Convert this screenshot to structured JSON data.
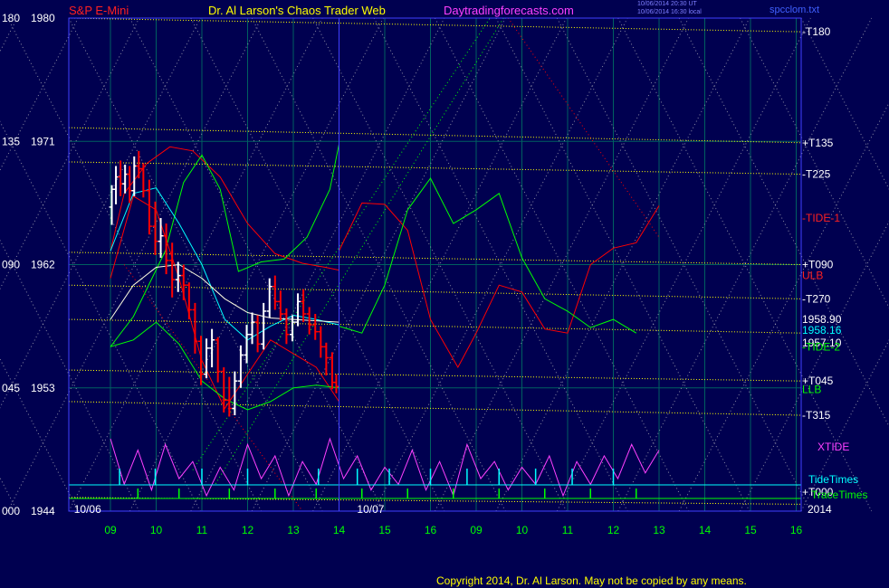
{
  "header": {
    "instrument": "S&P E-Mini",
    "author": "Dr. Al Larson's Chaos Trader Web",
    "site": "Daytradingforecasts.com",
    "timestamp_1": "10/06/2014 20:30 UT",
    "timestamp_2": "10/06/2014 16:30 local",
    "file": "spcclom.txt"
  },
  "colors": {
    "background": "#000050",
    "frame": "#4040ff",
    "grid": "#006060",
    "price_bar": "#ffffff",
    "price_bar_down": "#ff0000",
    "yellow": "#ffff00",
    "green": "#00ff00",
    "red": "#ff0000",
    "cyan": "#00ffff",
    "magenta": "#ff40ff"
  },
  "footer": {
    "copyright": "Copyright 2014, Dr. Al Larson. May not be copied by any means."
  },
  "chart_data": {
    "type": "line",
    "y_axis_left": {
      "range": [
        1944,
        1980
      ],
      "ticks": [
        {
          "angle": "180",
          "price": "1980"
        },
        {
          "angle": "135",
          "price": "1971"
        },
        {
          "angle": "090",
          "price": "1962"
        },
        {
          "angle": "045",
          "price": "1953"
        },
        {
          "angle": "000",
          "price": "1944"
        }
      ]
    },
    "x_axis": {
      "day_labels": [
        "10/06",
        "10/07"
      ],
      "year_label": "2014",
      "ticks": [
        {
          "hour": "09",
          "day": 1
        },
        {
          "hour": "10",
          "day": 1
        },
        {
          "hour": "11",
          "day": 1
        },
        {
          "hour": "12",
          "day": 1
        },
        {
          "hour": "13",
          "day": 1
        },
        {
          "hour": "14",
          "day": 1
        },
        {
          "hour": "15",
          "day": 1
        },
        {
          "hour": "16",
          "day": 1
        },
        {
          "hour": "09",
          "day": 2
        },
        {
          "hour": "10",
          "day": 2
        },
        {
          "hour": "11",
          "day": 2
        },
        {
          "hour": "12",
          "day": 2
        },
        {
          "hour": "13",
          "day": 2
        },
        {
          "hour": "14",
          "day": 2
        },
        {
          "hour": "15",
          "day": 2
        },
        {
          "hour": "16",
          "day": 2
        }
      ]
    },
    "grid": true,
    "right_labels": [
      {
        "text": "-T180",
        "price": 1979.0,
        "color": "#ffffff"
      },
      {
        "text": "+T135",
        "price": 1970.9,
        "color": "#ffffff"
      },
      {
        "text": "-T225",
        "price": 1968.6,
        "color": "#ffffff"
      },
      {
        "text": "-TIDE-1",
        "price": 1965.4,
        "color": "#ff2020"
      },
      {
        "text": "+T090",
        "price": 1962.0,
        "color": "#ffffff"
      },
      {
        "text": "ULB",
        "price": 1961.2,
        "color": "#ff2020"
      },
      {
        "text": "-T270",
        "price": 1959.5,
        "color": "#ffffff"
      },
      {
        "text": "1958.90",
        "price": 1958.0,
        "color": "#ffffff"
      },
      {
        "text": "1958.16",
        "price": 1957.2,
        "color": "#00ffff"
      },
      {
        "text": "1957.10",
        "price": 1956.3,
        "color": "#ffffff"
      },
      {
        "text": "-TIDE-2",
        "price": 1956.0,
        "color": "#00ff00"
      },
      {
        "text": "+T045",
        "price": 1953.5,
        "color": "#ffffff"
      },
      {
        "text": "LLB",
        "price": 1952.9,
        "color": "#00ff00"
      },
      {
        "text": "-T315",
        "price": 1951.0,
        "color": "#ffffff"
      }
    ],
    "lower_labels": [
      {
        "text": "XTIDE",
        "color": "#ff40ff"
      },
      {
        "text": "TideTimes",
        "color": "#00ffff"
      },
      {
        "text": "+T000",
        "color": "#ffffff"
      },
      {
        "text": "TraceTimes",
        "color": "#00ff00"
      }
    ],
    "time_lines": [
      {
        "name": "T180",
        "start": 1980.0,
        "end": 1979.0
      },
      {
        "name": "T135a",
        "start": 1972.0,
        "end": 1970.9
      },
      {
        "name": "T225",
        "start": 1969.5,
        "end": 1968.6
      },
      {
        "name": "T090",
        "start": 1962.9,
        "end": 1962.0
      },
      {
        "name": "T270",
        "start": 1960.5,
        "end": 1959.5
      },
      {
        "name": "Tmid",
        "start": 1958.0,
        "end": 1957.0
      },
      {
        "name": "T045",
        "start": 1954.3,
        "end": 1953.5
      },
      {
        "name": "T315",
        "start": 1952.0,
        "end": 1951.0
      },
      {
        "name": "T000",
        "start": 1945.0,
        "end": 1944.5
      }
    ],
    "price_bars": [
      {
        "t": 0.03,
        "o": 1966.2,
        "h": 1967.8,
        "l": 1964.9,
        "c": 1967.5
      },
      {
        "t": 0.12,
        "o": 1967.5,
        "h": 1969.2,
        "l": 1966.4,
        "c": 1968.4
      },
      {
        "t": 0.22,
        "o": 1968.4,
        "h": 1969.6,
        "l": 1967.0,
        "c": 1967.9
      },
      {
        "t": 0.32,
        "o": 1967.9,
        "h": 1969.3,
        "l": 1967.2,
        "c": 1968.6
      },
      {
        "t": 0.42,
        "o": 1968.6,
        "h": 1969.2,
        "l": 1966.5,
        "c": 1967.4
      },
      {
        "t": 0.52,
        "o": 1967.4,
        "h": 1969.9,
        "l": 1967.0,
        "c": 1969.2
      },
      {
        "t": 0.62,
        "o": 1969.2,
        "h": 1970.3,
        "l": 1968.3,
        "c": 1969.0
      },
      {
        "t": 0.72,
        "o": 1969.0,
        "h": 1969.4,
        "l": 1966.9,
        "c": 1967.4
      },
      {
        "t": 0.85,
        "o": 1967.4,
        "h": 1968.2,
        "l": 1964.2,
        "c": 1964.8
      },
      {
        "t": 0.98,
        "o": 1964.8,
        "h": 1966.6,
        "l": 1962.7,
        "c": 1963.7
      },
      {
        "t": 1.1,
        "o": 1963.7,
        "h": 1965.4,
        "l": 1962.5,
        "c": 1964.1
      },
      {
        "t": 1.22,
        "o": 1964.1,
        "h": 1965.0,
        "l": 1961.3,
        "c": 1962.3
      },
      {
        "t": 1.35,
        "o": 1962.3,
        "h": 1963.6,
        "l": 1959.6,
        "c": 1960.9
      },
      {
        "t": 1.48,
        "o": 1960.9,
        "h": 1962.2,
        "l": 1960.0,
        "c": 1961.2
      },
      {
        "t": 1.6,
        "o": 1961.2,
        "h": 1962.0,
        "l": 1959.4,
        "c": 1960.5
      },
      {
        "t": 1.72,
        "o": 1960.5,
        "h": 1960.7,
        "l": 1958.0,
        "c": 1958.7
      },
      {
        "t": 1.85,
        "o": 1958.7,
        "h": 1959.2,
        "l": 1955.5,
        "c": 1956.4
      },
      {
        "t": 1.98,
        "o": 1956.4,
        "h": 1956.8,
        "l": 1953.2,
        "c": 1954.0
      },
      {
        "t": 2.1,
        "o": 1954.0,
        "h": 1956.6,
        "l": 1953.7,
        "c": 1955.9
      },
      {
        "t": 2.22,
        "o": 1955.9,
        "h": 1957.3,
        "l": 1954.5,
        "c": 1956.5
      },
      {
        "t": 2.35,
        "o": 1956.5,
        "h": 1956.7,
        "l": 1953.4,
        "c": 1954.2
      },
      {
        "t": 2.48,
        "o": 1954.2,
        "h": 1954.5,
        "l": 1951.2,
        "c": 1952.1
      },
      {
        "t": 2.6,
        "o": 1952.1,
        "h": 1953.8,
        "l": 1950.9,
        "c": 1951.5
      },
      {
        "t": 2.72,
        "o": 1951.5,
        "h": 1954.2,
        "l": 1951.0,
        "c": 1953.5
      },
      {
        "t": 2.85,
        "o": 1953.5,
        "h": 1956.1,
        "l": 1953.0,
        "c": 1955.4
      },
      {
        "t": 2.98,
        "o": 1955.4,
        "h": 1957.6,
        "l": 1954.8,
        "c": 1956.9
      },
      {
        "t": 3.1,
        "o": 1956.9,
        "h": 1958.5,
        "l": 1956.2,
        "c": 1957.8
      },
      {
        "t": 3.22,
        "o": 1957.8,
        "h": 1958.3,
        "l": 1955.6,
        "c": 1956.2
      },
      {
        "t": 3.35,
        "o": 1956.2,
        "h": 1959.2,
        "l": 1955.8,
        "c": 1958.6
      },
      {
        "t": 3.48,
        "o": 1958.6,
        "h": 1961.0,
        "l": 1958.1,
        "c": 1960.4
      },
      {
        "t": 3.6,
        "o": 1960.4,
        "h": 1961.2,
        "l": 1958.7,
        "c": 1959.3
      },
      {
        "t": 3.72,
        "o": 1959.3,
        "h": 1960.1,
        "l": 1957.9,
        "c": 1958.4
      },
      {
        "t": 3.85,
        "o": 1958.4,
        "h": 1958.8,
        "l": 1956.2,
        "c": 1956.9
      },
      {
        "t": 3.98,
        "o": 1956.9,
        "h": 1958.3,
        "l": 1956.4,
        "c": 1957.8
      },
      {
        "t": 4.1,
        "o": 1957.8,
        "h": 1959.9,
        "l": 1957.5,
        "c": 1959.3
      },
      {
        "t": 4.22,
        "o": 1959.3,
        "h": 1960.2,
        "l": 1957.8,
        "c": 1958.4
      },
      {
        "t": 4.35,
        "o": 1958.4,
        "h": 1958.9,
        "l": 1956.9,
        "c": 1957.6
      },
      {
        "t": 4.48,
        "o": 1957.6,
        "h": 1958.4,
        "l": 1956.5,
        "c": 1957.1
      },
      {
        "t": 4.6,
        "o": 1957.1,
        "h": 1957.5,
        "l": 1955.2,
        "c": 1956.0
      },
      {
        "t": 4.72,
        "o": 1956.0,
        "h": 1956.3,
        "l": 1953.9,
        "c": 1955.2
      },
      {
        "t": 4.85,
        "o": 1955.2,
        "h": 1955.6,
        "l": 1952.9,
        "c": 1953.4
      },
      {
        "t": 4.94,
        "o": 1953.4,
        "h": 1954.0,
        "l": 1952.6,
        "c": 1953.1
      }
    ],
    "ulb_1": [
      [
        0,
        1963
      ],
      [
        0.3,
        1967.2
      ],
      [
        0.8,
        1969.4
      ],
      [
        1.3,
        1970.6
      ],
      [
        1.8,
        1970.3
      ],
      [
        2.4,
        1968.4
      ],
      [
        3.0,
        1965.0
      ],
      [
        3.6,
        1962.8
      ],
      [
        4.2,
        1962.1
      ],
      [
        4.7,
        1961.8
      ],
      [
        5.0,
        1961.6
      ]
    ],
    "llb_1": [
      [
        0,
        1956
      ],
      [
        0.5,
        1958.2
      ],
      [
        1.2,
        1963
      ],
      [
        1.6,
        1968
      ],
      [
        2.0,
        1970.0
      ],
      [
        2.4,
        1967.5
      ],
      [
        2.8,
        1961.5
      ],
      [
        3.3,
        1962.2
      ],
      [
        3.8,
        1962.4
      ],
      [
        4.3,
        1964
      ],
      [
        4.8,
        1967.5
      ],
      [
        5.0,
        1970.8
      ]
    ],
    "ma_cyan": [
      [
        0,
        1963
      ],
      [
        0.5,
        1967.2
      ],
      [
        1.0,
        1967.6
      ],
      [
        1.5,
        1965.0
      ],
      [
        2.0,
        1962.0
      ],
      [
        2.5,
        1958.0
      ],
      [
        3.0,
        1956.5
      ],
      [
        3.5,
        1957.5
      ],
      [
        4.0,
        1958.3
      ],
      [
        4.5,
        1958.0
      ],
      [
        5.0,
        1957.6
      ]
    ],
    "ma_white": [
      [
        0,
        1958
      ],
      [
        0.5,
        1960.5
      ],
      [
        1.0,
        1961.8
      ],
      [
        1.5,
        1962.0
      ],
      [
        2.0,
        1961.0
      ],
      [
        2.5,
        1959.5
      ],
      [
        3.0,
        1958.5
      ],
      [
        3.5,
        1958.1
      ],
      [
        4.0,
        1958.0
      ],
      [
        4.5,
        1957.9
      ],
      [
        5.0,
        1957.8
      ]
    ],
    "band_red_inner": [
      [
        0,
        1961
      ],
      [
        0.5,
        1967.0
      ],
      [
        1.0,
        1966.0
      ],
      [
        1.5,
        1961.0
      ],
      [
        2.0,
        1955.0
      ],
      [
        2.5,
        1951.5
      ],
      [
        3.0,
        1954.0
      ],
      [
        3.5,
        1956.5
      ],
      [
        4.0,
        1955.5
      ],
      [
        4.5,
        1954.5
      ],
      [
        5.0,
        1952.0
      ]
    ],
    "band_green_low": [
      [
        0,
        1956
      ],
      [
        0.5,
        1956.5
      ],
      [
        1.0,
        1957.8
      ],
      [
        1.5,
        1956.2
      ],
      [
        2.0,
        1953.5
      ],
      [
        2.5,
        1952.2
      ],
      [
        3.0,
        1951.4
      ],
      [
        3.5,
        1952.0
      ],
      [
        4.0,
        1953.0
      ],
      [
        4.5,
        1953.2
      ],
      [
        5.0,
        1953.0
      ]
    ],
    "tide1_red": [
      [
        5.0,
        1963.0
      ],
      [
        5.5,
        1966.5
      ],
      [
        6.0,
        1966.4
      ],
      [
        6.5,
        1964.5
      ],
      [
        7.0,
        1958.0
      ],
      [
        7.6,
        1954.5
      ],
      [
        8.0,
        1957.0
      ],
      [
        8.5,
        1960.5
      ],
      [
        9.0,
        1960.0
      ],
      [
        9.5,
        1957.3
      ],
      [
        10.0,
        1957.0
      ],
      [
        10.5,
        1962.0
      ],
      [
        11.0,
        1963.2
      ],
      [
        11.5,
        1963.6
      ],
      [
        12.0,
        1966.3
      ]
    ],
    "tide2_green": [
      [
        5.0,
        1957.5
      ],
      [
        5.5,
        1957.0
      ],
      [
        6.0,
        1960.5
      ],
      [
        6.5,
        1966.0
      ],
      [
        7.0,
        1968.3
      ],
      [
        7.5,
        1965.0
      ],
      [
        8.0,
        1966.0
      ],
      [
        8.5,
        1967.2
      ],
      [
        9.0,
        1962.5
      ],
      [
        9.5,
        1959.5
      ],
      [
        10.0,
        1958.6
      ],
      [
        10.5,
        1957.4
      ],
      [
        11.0,
        1958.0
      ],
      [
        11.5,
        1957.0
      ]
    ],
    "xtide": [
      [
        0,
        1.0
      ],
      [
        0.3,
        0.2
      ],
      [
        0.6,
        0.8
      ],
      [
        0.9,
        0.1
      ],
      [
        1.2,
        0.9
      ],
      [
        1.5,
        0.3
      ],
      [
        1.8,
        0.6
      ],
      [
        2.1,
        0.0
      ],
      [
        2.4,
        0.5
      ],
      [
        2.7,
        0.1
      ],
      [
        3.0,
        0.9
      ],
      [
        3.3,
        0.3
      ],
      [
        3.6,
        0.7
      ],
      [
        3.9,
        0.0
      ],
      [
        4.2,
        0.6
      ],
      [
        4.5,
        0.2
      ],
      [
        4.8,
        1.0
      ],
      [
        5.1,
        0.3
      ],
      [
        5.4,
        0.7
      ],
      [
        5.7,
        0.1
      ],
      [
        6.0,
        0.5
      ],
      [
        6.3,
        0.2
      ],
      [
        6.6,
        0.8
      ],
      [
        6.9,
        0.1
      ],
      [
        7.2,
        0.6
      ],
      [
        7.5,
        0.0
      ],
      [
        7.8,
        0.9
      ],
      [
        8.1,
        0.3
      ],
      [
        8.4,
        0.6
      ],
      [
        8.7,
        0.1
      ],
      [
        9.0,
        0.5
      ],
      [
        9.3,
        0.2
      ],
      [
        9.6,
        0.7
      ],
      [
        9.9,
        0.0
      ],
      [
        10.2,
        0.6
      ],
      [
        10.5,
        0.2
      ],
      [
        10.8,
        0.7
      ],
      [
        11.1,
        0.3
      ],
      [
        11.4,
        0.9
      ],
      [
        11.7,
        0.4
      ],
      [
        12.0,
        0.8
      ]
    ],
    "tide_times": [
      0.2,
      0.98,
      2.0,
      3.0,
      4.55,
      5.4,
      6.1,
      7.0,
      7.8,
      8.5,
      9.3,
      10.1,
      11.0
    ],
    "trace_times": [
      0.6,
      1.5,
      2.6,
      3.6,
      4.5,
      5.5,
      6.5,
      7.5,
      8.5,
      9.5,
      10.5,
      11.5
    ]
  }
}
